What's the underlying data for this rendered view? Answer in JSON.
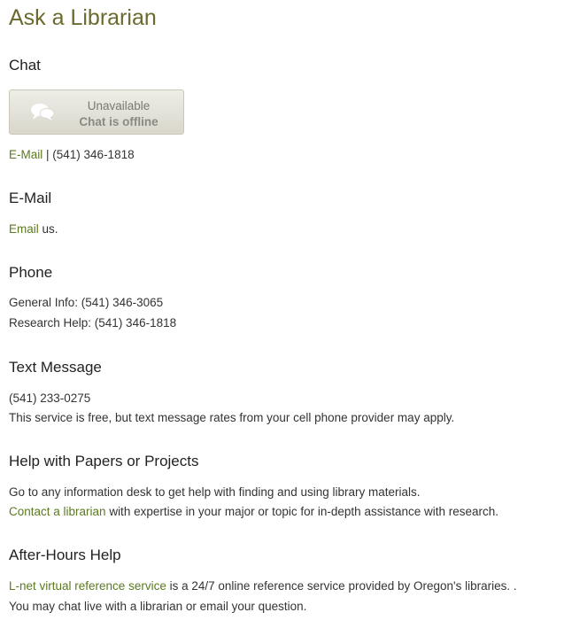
{
  "title": "Ask a Librarian",
  "chat": {
    "heading": "Chat",
    "button_status": "Unavailable",
    "button_text": "Chat is offline",
    "email_link": "E-Mail",
    "separator_phone": " | (541) 346-1818"
  },
  "email": {
    "heading": "E-Mail",
    "link": "Email",
    "suffix": " us."
  },
  "phone": {
    "heading": "Phone",
    "general": "General Info: (541) 346-3065",
    "research": "Research Help: (541) 346-1818"
  },
  "text_message": {
    "heading": "Text Message",
    "number": "(541) 233-0275",
    "note": "This service is free, but text message rates from your cell phone provider may apply."
  },
  "papers": {
    "heading": "Help with Papers or Projects",
    "line1": "Go to any information desk to get help with finding and using library materials.",
    "link": "Contact a librarian",
    "line2_suffix": " with expertise in your major or topic for in-depth assistance with research."
  },
  "after_hours": {
    "heading": "After-Hours Help",
    "link": "L-net virtual reference service",
    "line1_suffix": " is a 24/7 online reference service provided by Oregon's libraries. .",
    "line2": "You may chat live with a librarian or email your question."
  },
  "colors": {
    "title": "#6b6a2e",
    "link": "#5b7a1f",
    "text": "#333333"
  },
  "icons": {
    "chat_button": "speech-bubbles-icon"
  }
}
